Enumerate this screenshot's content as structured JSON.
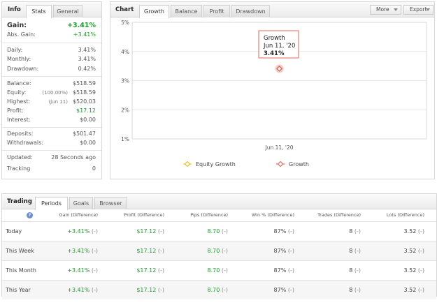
{
  "info": {
    "title": "Info",
    "tabs": [
      "Stats",
      "General"
    ],
    "gain_label": "Gain:",
    "gain_value": "+3.41%",
    "abs_gain_label": "Abs. Gain:",
    "abs_gain_value": "+3.41%",
    "daily_label": "Daily:",
    "daily_value": "3.41%",
    "monthly_label": "Monthly:",
    "monthly_value": "3.41%",
    "drawdown_label": "Drawdown:",
    "drawdown_value": "0.42%",
    "balance_label": "Balance:",
    "balance_value": "$518.59",
    "equity_label": "Equity:",
    "equity_note": "(100.00%)",
    "equity_value": "$518.59",
    "highest_label": "Highest:",
    "highest_note": "(Jun 11)",
    "highest_value": "$520.03",
    "profit_label": "Profit:",
    "profit_value": "$17.12",
    "interest_label": "Interest:",
    "interest_value": "$0.00",
    "deposits_label": "Deposits:",
    "deposits_value": "$501.47",
    "withdrawals_label": "Withdrawals:",
    "withdrawals_value": "$0.00",
    "updated_label": "Updated:",
    "updated_value": "28 Seconds ago",
    "tracking_label": "Tracking",
    "tracking_value": "0"
  },
  "chart": {
    "title": "Chart",
    "tabs": [
      "Growth",
      "Balance",
      "Profit",
      "Drawdown"
    ],
    "more_label": "More",
    "export_label": "Export",
    "tooltip": {
      "series": "Growth",
      "date": "Jun 11, '20",
      "value": "3.41%"
    },
    "legend": [
      "Equity Growth",
      "Growth"
    ],
    "colors": {
      "equity": "#f0b400",
      "growth": "#e8564a"
    }
  },
  "chart_data": {
    "type": "line",
    "x": [
      "Jun 11, '20"
    ],
    "series": [
      {
        "name": "Growth",
        "values": [
          3.41
        ]
      },
      {
        "name": "Equity Growth",
        "values": [
          3.41
        ]
      }
    ],
    "yticks": [
      "5%",
      "4%",
      "3%",
      "2%",
      "1%"
    ],
    "ylim": [
      1,
      5
    ],
    "grid": true,
    "legend_position": "bottom"
  },
  "trading": {
    "title": "Trading",
    "tabs": [
      "Periods",
      "Goals",
      "Browser"
    ],
    "help_icon": "?",
    "columns": [
      "Gain (Difference)",
      "Profit (Difference)",
      "Pips (Difference)",
      "Win % (Difference)",
      "Trades (Difference)",
      "Lots (Difference)"
    ],
    "rows": [
      {
        "name": "Today",
        "gain": "+3.41%",
        "profit": "$17.12",
        "pips": "8.70",
        "win": "87%",
        "trades": "8",
        "lots": "3.52",
        "diff": "(-)"
      },
      {
        "name": "This Week",
        "gain": "+3.41%",
        "profit": "$17.12",
        "pips": "8.70",
        "win": "87%",
        "trades": "8",
        "lots": "3.52",
        "diff": "(-)"
      },
      {
        "name": "This Month",
        "gain": "+3.41%",
        "profit": "$17.12",
        "pips": "8.70",
        "win": "87%",
        "trades": "8",
        "lots": "3.52",
        "diff": "(-)"
      },
      {
        "name": "This Year",
        "gain": "+3.41%",
        "profit": "$17.12",
        "pips": "8.70",
        "win": "87%",
        "trades": "8",
        "lots": "3.52",
        "diff": "(-)"
      }
    ]
  }
}
